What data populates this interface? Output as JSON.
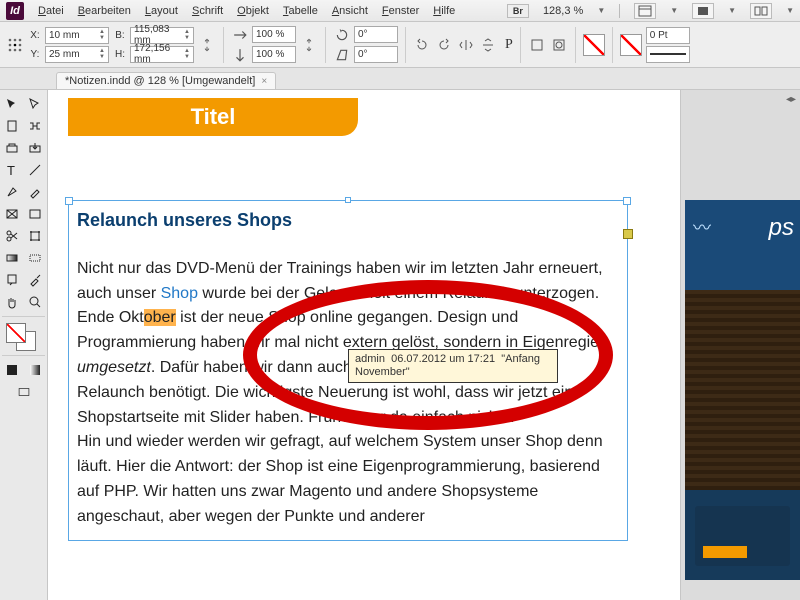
{
  "menu": {
    "items": [
      "Datei",
      "Bearbeiten",
      "Layout",
      "Schrift",
      "Objekt",
      "Tabelle",
      "Ansicht",
      "Fenster",
      "Hilfe"
    ],
    "bridge_label": "Br",
    "zoom": "128,3 %"
  },
  "ctrl": {
    "x_label": "X:",
    "x_val": "10 mm",
    "y_label": "Y:",
    "y_val": "25 mm",
    "w_label": "B:",
    "w_val": "115,083 mm",
    "h_label": "H:",
    "h_val": "172,156 mm",
    "scale_x": "100 %",
    "scale_y": "100 %",
    "rot": "0°",
    "shear": "0°",
    "stroke_pt": "0 Pt"
  },
  "tab": {
    "title": "*Notizen.indd @ 128 % [Umgewandelt]"
  },
  "doc": {
    "title_banner": "Titel",
    "heading": "Relaunch unseres Shops",
    "p1a": "Nicht nur das DVD-Menü der Trainings haben wir im letzten Jahr erneuert, auch unser ",
    "shop_link": "Shop",
    "p1b": " wurde bei der Gelegenheit einem Relaunch unterzogen. Ende Okt",
    "note_marked": "ober",
    "p1c": " ist der neue Shop online ge­gangen. Design und Programmierung haben wir mal nicht extern gelöst, sondern in Eigenregie ",
    "italic": "umgesetzt",
    "p1d": ". Dafür haben wir dann auch sechs Wochen allein für den Relaunch benötigt. Die wichtigste Neu­erung ist wohl, dass wir jetzt eine Shopstartseite mit Slider haben. Früher war da einfach nichts.",
    "p2": "Hin und wieder werden wir gefragt, auf welchem System unser Shop denn läuft. Hier die Antwort: der Shop ist eine Eigenprogram­mierung, basierend auf PHP. Wir hatten uns zwar Magento und an­dere Shopsysteme angeschaut, aber wegen der Punkte und anderer"
  },
  "note": {
    "author": "admin",
    "datetime": "06.07.2012 um 17:21",
    "text": "\"Anfang November\""
  }
}
